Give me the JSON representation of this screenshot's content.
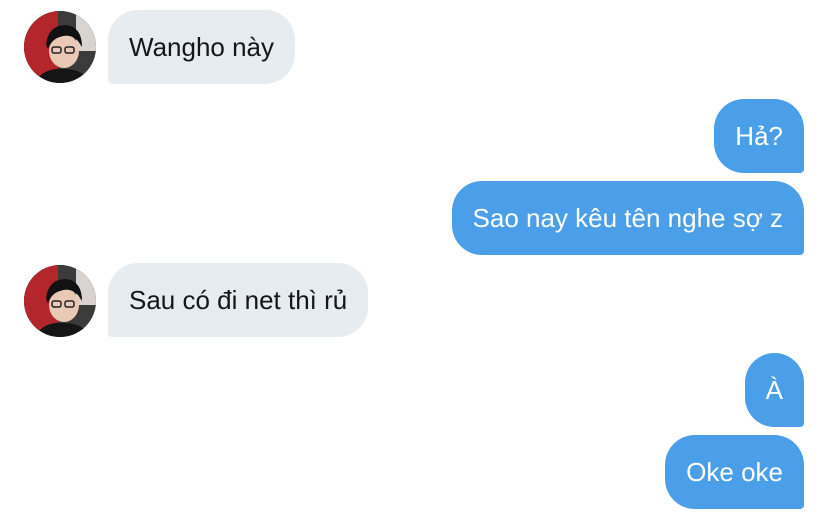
{
  "conversation": {
    "messages": [
      {
        "direction": "incoming",
        "text": "Wangho này"
      },
      {
        "direction": "outgoing",
        "text": "Hả?"
      },
      {
        "direction": "outgoing",
        "text": "Sao nay kêu tên nghe sợ z"
      },
      {
        "direction": "incoming",
        "text": "Sau có đi net thì rủ"
      },
      {
        "direction": "outgoing",
        "text": "À"
      },
      {
        "direction": "outgoing",
        "text": "Oke oke"
      }
    ]
  },
  "colors": {
    "incoming_bubble": "#e6ecf0",
    "outgoing_bubble": "#4a9fe8",
    "incoming_text": "#14171a",
    "outgoing_text": "#ffffff"
  }
}
